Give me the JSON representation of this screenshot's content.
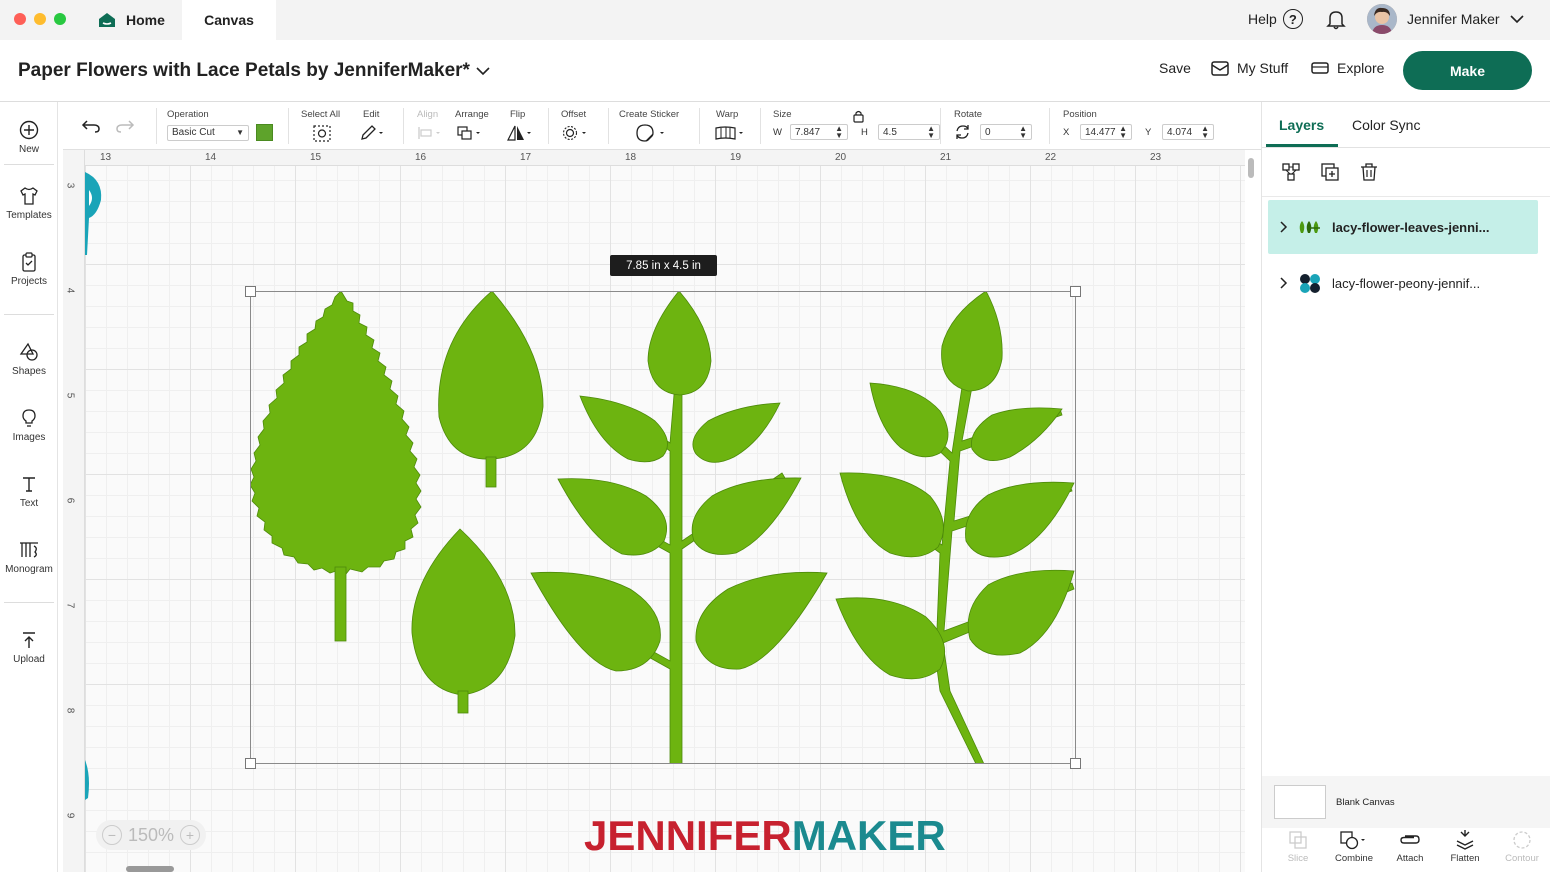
{
  "window": {
    "traffic_colors": [
      "#fe5f57",
      "#febc2e",
      "#28c840"
    ]
  },
  "tabs": {
    "home_label": "Home",
    "canvas_label": "Canvas"
  },
  "topbar": {
    "help_label": "Help",
    "help_glyph": "?",
    "user_name": "Jennifer Maker"
  },
  "header": {
    "project_title": "Paper Flowers with Lace Petals by JenniferMaker*",
    "save_label": "Save",
    "mystuff_label": "My Stuff",
    "explore_label": "Explore",
    "make_label": "Make"
  },
  "sidebar": {
    "items": [
      {
        "label": "New",
        "icon": "plus-circle-icon"
      },
      {
        "label": "Templates",
        "icon": "shirt-icon"
      },
      {
        "label": "Projects",
        "icon": "clipboard-icon"
      },
      {
        "label": "Shapes",
        "icon": "shapes-icon"
      },
      {
        "label": "Images",
        "icon": "lightbulb-icon"
      },
      {
        "label": "Text",
        "icon": "text-icon"
      },
      {
        "label": "Monogram",
        "icon": "monogram-icon"
      },
      {
        "label": "Upload",
        "icon": "upload-icon"
      }
    ]
  },
  "toolbar": {
    "operation_label": "Operation",
    "operation_value": "Basic Cut",
    "operation_color": "#5ea32b",
    "select_all_label": "Select All",
    "edit_label": "Edit",
    "align_label": "Align",
    "arrange_label": "Arrange",
    "flip_label": "Flip",
    "offset_label": "Offset",
    "create_sticker_label": "Create Sticker",
    "warp_label": "Warp",
    "size_label": "Size",
    "w_label": "W",
    "w_value": "7.847",
    "h_label": "H",
    "h_value": "4.5",
    "rotate_label": "Rotate",
    "rotate_value": "0",
    "position_label": "Position",
    "x_label": "X",
    "x_value": "14.477",
    "y_label": "Y",
    "y_value": "4.074"
  },
  "rulers": {
    "top": [
      "13",
      "14",
      "15",
      "16",
      "17",
      "18",
      "19",
      "20",
      "21",
      "22",
      "23"
    ],
    "left": [
      "3",
      "4",
      "5",
      "6",
      "7",
      "8",
      "9"
    ]
  },
  "canvas": {
    "size_tooltip": "7.85  in x 4.5  in",
    "leaf_color": "#6db410",
    "stem_color": "#5fa00c",
    "zoom_label": "150%",
    "zoom_minus": "−",
    "zoom_plus": "+"
  },
  "watermark": {
    "part1": "JENNIFER",
    "part2": "MAKER",
    "color1": "#c7212f",
    "color2": "#1b8a8f"
  },
  "layers_panel": {
    "tab_layers": "Layers",
    "tab_color_sync": "Color Sync",
    "accent": "#0e6d55",
    "layers": [
      {
        "name": "lacy-flower-leaves-jenni...",
        "selected": true
      },
      {
        "name": "lacy-flower-peony-jennif...",
        "selected": false
      }
    ],
    "blank_canvas_label": "Blank Canvas",
    "bottom_tools": [
      {
        "label": "Slice",
        "enabled": false
      },
      {
        "label": "Combine",
        "enabled": true
      },
      {
        "label": "Attach",
        "enabled": true
      },
      {
        "label": "Flatten",
        "enabled": true
      },
      {
        "label": "Contour",
        "enabled": false
      }
    ]
  }
}
